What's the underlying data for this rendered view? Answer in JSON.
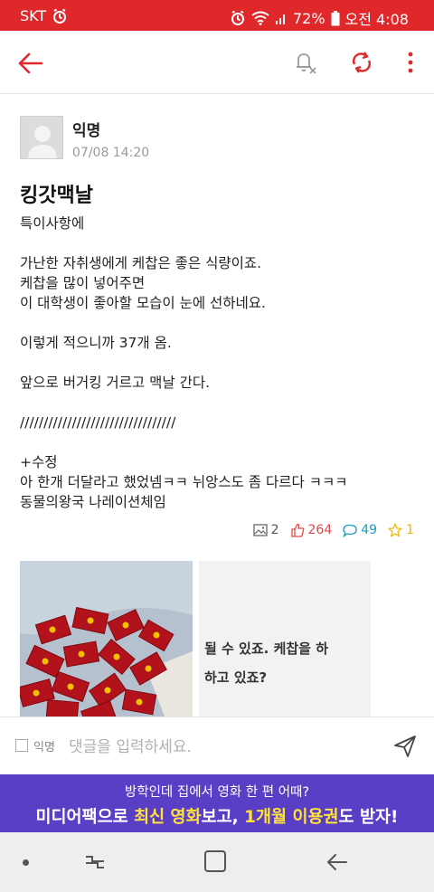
{
  "status_bar": {
    "carrier": "SKT",
    "battery": "72%",
    "time": "오전 4:08"
  },
  "author": {
    "name": "익명",
    "datetime": "07/08 14:20"
  },
  "post": {
    "title": "킹갓맥날",
    "body": "특이사항에\n\n가난한 자취생에게 케찹은 좋은 식량이죠.\n케찹을 많이 넣어주면\n이 대학생이 좋아할 모습이 눈에 선하네요.\n\n이렇게 적으니까 37개 옴.\n\n앞으로 버거킹 거르고 맥날 간다.\n\n/////////////////////////////////\n\n+수정\n아 한개 더달라고 했었넴ㅋㅋ 뉘앙스도 좀 다르다 ㅋㅋㅋ\n동물의왕국 나레이션체임"
  },
  "stats": {
    "images": "2",
    "likes": "264",
    "comments": "49",
    "scraps": "1"
  },
  "thumbnail_text": {
    "line1": "될 수 있죠. 케찹을 하",
    "line2": "하고 있죠?"
  },
  "comment": {
    "anonymous_label": "익명",
    "placeholder": "댓글을 입력하세요."
  },
  "banner": {
    "line1": "방학인데 집에서 영화 한 편 어때?",
    "line2_part1": "미디어팩으로 ",
    "line2_hl1": "최신 영화",
    "line2_part2": "보고, ",
    "line2_hl2": "1개월 이용권",
    "line2_part3": "도 받자!"
  },
  "colors": {
    "accent_red": "#e0282b",
    "likes": "#e04848",
    "comments": "#1a9cc2",
    "scraps": "#f0b400",
    "banner": "#5a3fc6",
    "highlight": "#ffe23a"
  },
  "icons": {
    "back": "arrow-left-icon",
    "notify": "bell-off-icon",
    "refresh": "refresh-icon",
    "more": "more-vertical-icon",
    "image": "image-icon",
    "like": "thumbs-up-icon",
    "comment": "comment-icon",
    "scrap": "star-icon",
    "send": "send-icon"
  }
}
